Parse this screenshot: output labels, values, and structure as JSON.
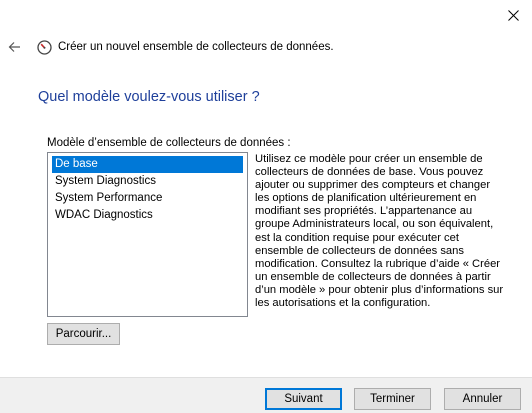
{
  "window": {
    "close_icon": "close-icon"
  },
  "header": {
    "back_icon": "back-arrow-icon",
    "wizard_icon": "performance-monitor-icon",
    "title": "Créer un nouvel ensemble de collecteurs de données."
  },
  "page": {
    "question": "Quel modèle voulez-vous utiliser ?"
  },
  "templates": {
    "label": "Modèle d’ensemble de collecteurs de données :",
    "selected_index": 0,
    "items": [
      {
        "label": "De base"
      },
      {
        "label": "System Diagnostics"
      },
      {
        "label": "System Performance"
      },
      {
        "label": "WDAC Diagnostics"
      }
    ],
    "description": "Utilisez ce modèle pour créer un ensemble de collecteurs de données de base. Vous pouvez ajouter ou supprimer des compteurs et changer les options de planification ultérieurement en modifiant ses propriétés. L’appartenance au groupe Administrateurs local, ou son équivalent, est la condition requise pour exécuter cet ensemble de collecteurs de données sans modification. Consultez la rubrique d’aide « Créer un ensemble de collecteurs de données à partir d’un modèle » pour obtenir plus d’informations sur les autorisations et la configuration.",
    "browse_label": "Parcourir..."
  },
  "footer": {
    "next_label": "Suivant",
    "finish_label": "Terminer",
    "cancel_label": "Annuler"
  },
  "colors": {
    "accent": "#0078d7",
    "heading": "#1e3f9a",
    "footer_bg": "#f0f0f0"
  }
}
